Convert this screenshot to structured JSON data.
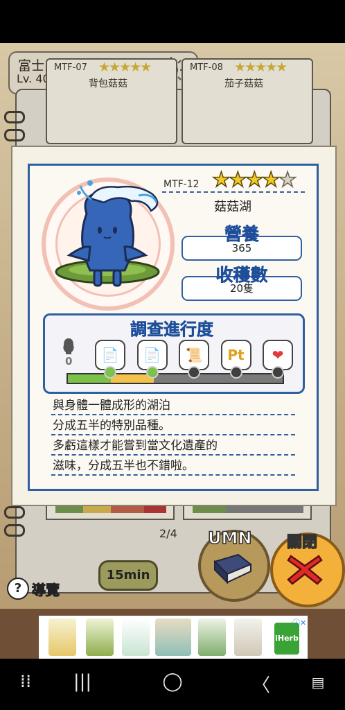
{
  "area": {
    "name": "富士山",
    "level": "Lv. 40",
    "level_progress": 0.72
  },
  "notebook_cards": [
    {
      "code": "MTF-07",
      "stars": 4,
      "title": "背包菇菇"
    },
    {
      "code": "MTF-08",
      "stars": 4,
      "title": "茄子菇菇"
    }
  ],
  "popup": {
    "code": "MTF-12",
    "stars": {
      "filled": 4,
      "total": 5
    },
    "name": "菇菇湖",
    "nutrition_label": "營養",
    "nutrition_value": "365",
    "harvest_label": "收穫數",
    "harvest_value": "20隻",
    "progress_title": "調查進行度",
    "progress_count": "0",
    "progress_steps": [
      "document-icon",
      "document-icon",
      "certificate-icon",
      "pt-icon",
      "heart-icon"
    ],
    "progress_segments": [
      {
        "color": "#7cc24a",
        "fraction": 0.2
      },
      {
        "color": "#f2c24a",
        "fraction": 0.2
      },
      {
        "color": "#7a7a7a",
        "fraction": 0.6
      }
    ],
    "description": [
      "與身體一體成形的湖泊",
      "分成五半的特別品種。",
      "多虧這樣才能嘗到當文化遺產的",
      "滋味，分成五半也不錯啦。"
    ]
  },
  "page_counter": "2/4",
  "buttons": {
    "umn": "UMN",
    "close": "關閉",
    "guide": "導覽",
    "guide_icon": "?"
  },
  "timer": "15min",
  "ad": {
    "brand": "iHerb"
  },
  "nav": {
    "apps": "⁞⁞",
    "recent": "|||",
    "home": "◯",
    "back": "〈"
  }
}
